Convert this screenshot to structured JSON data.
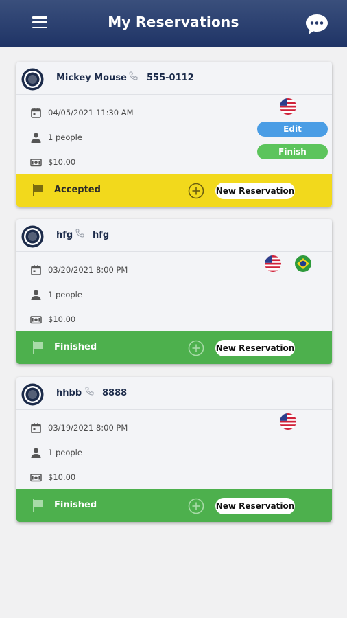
{
  "header": {
    "title": "My Reservations",
    "menu_icon": "hamburger-menu-icon",
    "chat_icon": "chat-bubble-icon"
  },
  "colors": {
    "appbar": "#26396b",
    "accepted": "#f2d91c",
    "finished": "#4db04d",
    "edit": "#4a9de5",
    "finish": "#5cc45c"
  },
  "reservations": [
    {
      "guest": "Mickey Mouse",
      "phone": "555-0112",
      "datetime": "04/05/2021 11:30 AM",
      "people": "1 people",
      "price": "$10.00",
      "flags": [
        "us-flag"
      ],
      "edit_label": "Edit",
      "finish_label": "Finish",
      "status": "Accepted",
      "new_label": "New Reservation"
    },
    {
      "guest": "hfg",
      "phone": "hfg",
      "datetime": "03/20/2021 8:00 PM",
      "people": "1 people",
      "price": "$10.00",
      "flags": [
        "us-flag",
        "brazil-flag"
      ],
      "status": "Finished",
      "new_label": "New Reservation"
    },
    {
      "guest": "hhbb",
      "phone": "8888",
      "datetime": "03/19/2021 8:00 PM",
      "people": "1 people",
      "price": "$10.00",
      "flags": [
        "us-flag"
      ],
      "status": "Finished",
      "new_label": "New Reservation"
    }
  ]
}
